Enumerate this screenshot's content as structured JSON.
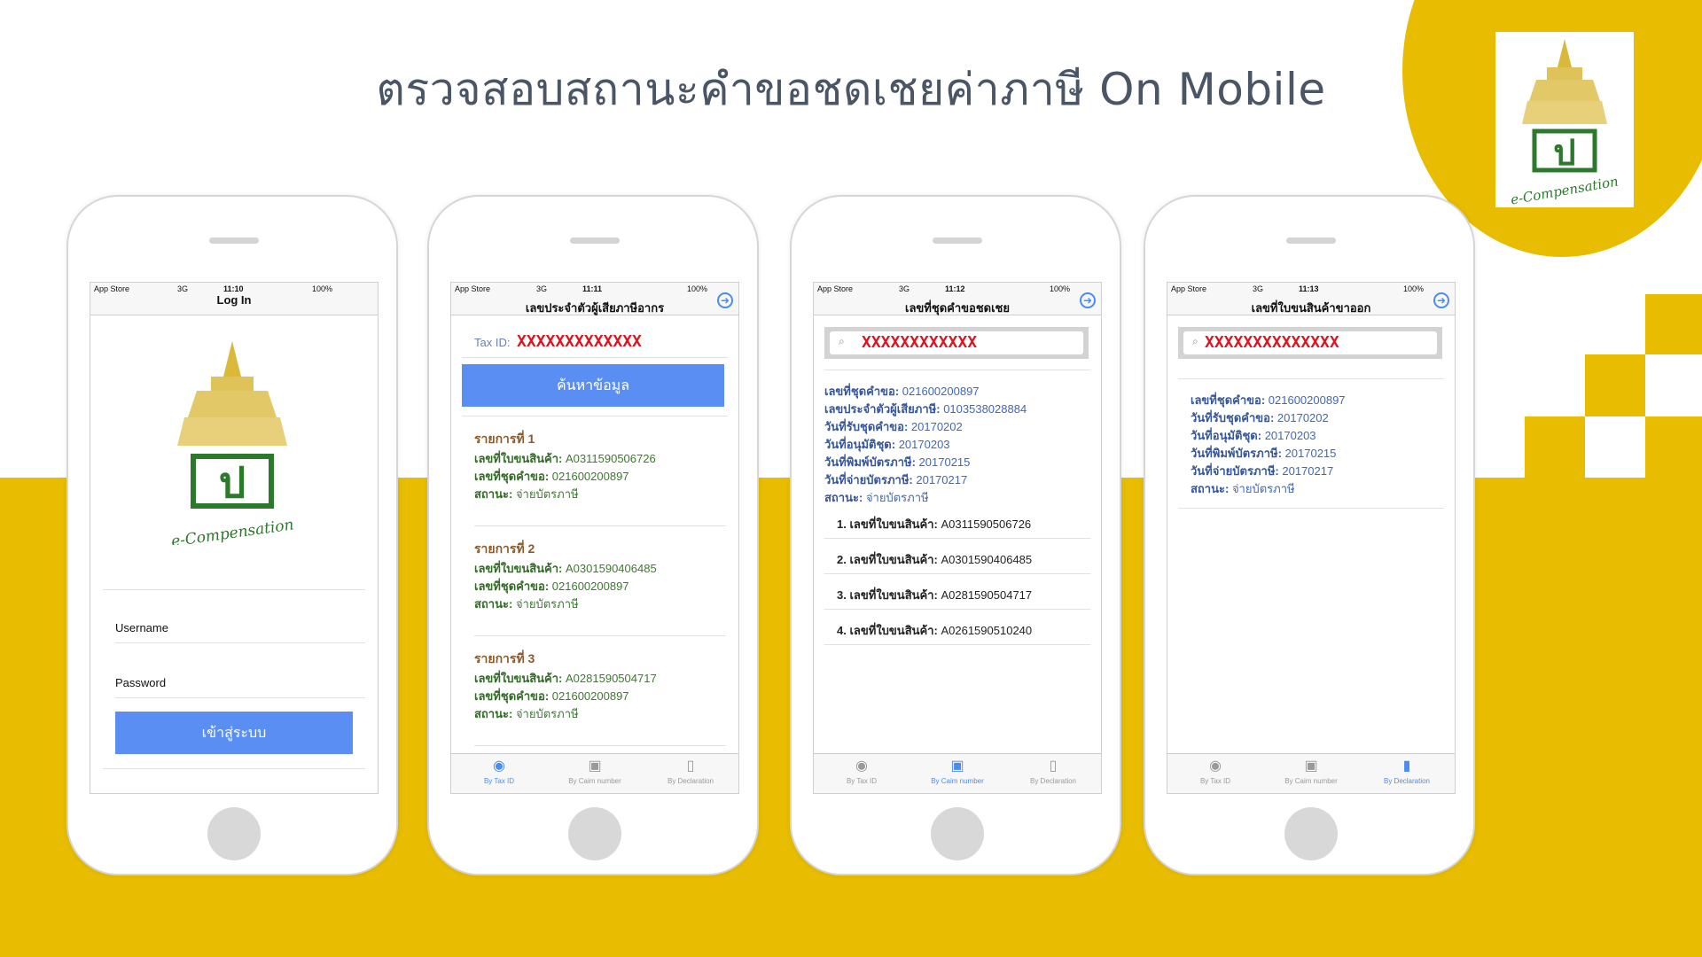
{
  "title": "ตรวจสอบสถานะคำขอชดเชยค่าภาษี On Mobile",
  "colors": {
    "accent": "#e8bc00",
    "button": "#5b8ef2",
    "tab_active": "#4a8cf5"
  },
  "brand": {
    "logo_text": "e-Compensation",
    "icon": "royal-crown-emblem-icon"
  },
  "status_bar": {
    "carrier": "App Store",
    "net": "3G",
    "battery": "100%"
  },
  "phones": {
    "login": {
      "time": "11:10",
      "nav_title": "Log In",
      "username_label": "Username",
      "password_label": "Password",
      "login_button": "เข้าสู่ระบบ"
    },
    "taxid": {
      "time": "11:11",
      "nav_title": "เลขประจำตัวผู้เสียภาษีอากร",
      "tax_label": "Tax ID:",
      "tax_value": "XXXXXXXXXXXXX",
      "search_button": "ค้นหาข้อมูล",
      "items": [
        {
          "heading": "รายการที่ 1",
          "invoice_label": "เลขที่ใบขนสินค้า:",
          "invoice": "A0311590506726",
          "claim_label": "เลขที่ชุดคำขอ:",
          "claim": "021600200897",
          "status_label": "สถานะ:",
          "status": "จ่ายบัตรภาษี"
        },
        {
          "heading": "รายการที่ 2",
          "invoice_label": "เลขที่ใบขนสินค้า:",
          "invoice": "A0301590406485",
          "claim_label": "เลขที่ชุดคำขอ:",
          "claim": "021600200897",
          "status_label": "สถานะ:",
          "status": "จ่ายบัตรภาษี"
        },
        {
          "heading": "รายการที่ 3",
          "invoice_label": "เลขที่ใบขนสินค้า:",
          "invoice": "A0281590504717",
          "claim_label": "เลขที่ชุดคำขอ:",
          "claim": "021600200897",
          "status_label": "สถานะ:",
          "status": "จ่ายบัตรภาษี"
        }
      ]
    },
    "claim": {
      "time": "11:12",
      "nav_title": "เลขที่ชุดคำขอชดเชย",
      "search_value": "XXXXXXXXXXXX",
      "details": [
        {
          "label": "เลขที่ชุดคำขอ:",
          "value": "021600200897"
        },
        {
          "label": "เลขประจำตัวผู้เสียภาษี:",
          "value": "0103538028884"
        },
        {
          "label": "วันที่รับชุดคำขอ:",
          "value": "20170202"
        },
        {
          "label": "วันที่อนุมัติชุด:",
          "value": "20170203"
        },
        {
          "label": "วันที่พิมพ์บัตรภาษี:",
          "value": "20170215"
        },
        {
          "label": "วันที่จ่ายบัตรภาษี:",
          "value": "20170217"
        },
        {
          "label": "สถานะ:",
          "value": "จ่ายบัตรภาษี"
        }
      ],
      "invoices": [
        {
          "label": "1. เลขที่ใบขนสินค้า:",
          "value": "A0311590506726"
        },
        {
          "label": "2. เลขที่ใบขนสินค้า:",
          "value": "A0301590406485"
        },
        {
          "label": "3. เลขที่ใบขนสินค้า:",
          "value": "A0281590504717"
        },
        {
          "label": "4. เลขที่ใบขนสินค้า:",
          "value": "A0261590510240"
        }
      ]
    },
    "declaration": {
      "time": "11:13",
      "nav_title": "เลขที่ใบขนสินค้าขาออก",
      "search_value": "XXXXXXXXXXXXXX",
      "details": [
        {
          "label": "เลขที่ชุดคำขอ:",
          "value": "021600200897"
        },
        {
          "label": "วันที่รับชุดคำขอ:",
          "value": "20170202"
        },
        {
          "label": "วันที่อนุมัติชุด:",
          "value": "20170203"
        },
        {
          "label": "วันที่พิมพ์บัตรภาษี:",
          "value": "20170215"
        },
        {
          "label": "วันที่จ่ายบัตรภาษี:",
          "value": "20170217"
        },
        {
          "label": "สถานะ:",
          "value": "จ่ายบัตรภาษี"
        }
      ]
    }
  },
  "tabs": [
    {
      "label": "By Tax ID",
      "icon": "user-circle-icon"
    },
    {
      "label": "By Caim number",
      "icon": "cc-card-icon"
    },
    {
      "label": "By Declaration",
      "icon": "clipboard-icon"
    }
  ]
}
